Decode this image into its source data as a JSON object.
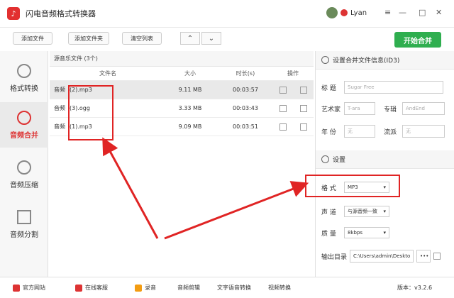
{
  "app": {
    "title": "闪电音频格式转换器",
    "username": "Lyan",
    "logo_glyph": "♪"
  },
  "window": {
    "min": "—",
    "max": "□",
    "close": "✕",
    "menu": "≡"
  },
  "toolbar": {
    "add_file": "添加文件",
    "add_folder": "添加文件夹",
    "clear_list": "清空列表",
    "up": "⌃",
    "down": "⌄",
    "start": "开始合并"
  },
  "sidebar": [
    {
      "label": "格式转换",
      "icon": "refresh-icon"
    },
    {
      "label": "音频合并",
      "icon": "merge-icon"
    },
    {
      "label": "音频压缩",
      "icon": "compress-icon"
    },
    {
      "label": "音频分割",
      "icon": "split-icon"
    }
  ],
  "filelist": {
    "title": "源音乐文件 (3个)",
    "headers": {
      "name": "文件名",
      "size": "大小",
      "duration": "时长(s)",
      "ops": "操作"
    },
    "rows": [
      {
        "prefix": "音频",
        "name": "(2).mp3",
        "size": "9.11 MB",
        "duration": "00:03:57"
      },
      {
        "prefix": "音频",
        "name": "(3).ogg",
        "size": "3.33 MB",
        "duration": "00:03:43"
      },
      {
        "prefix": "音频",
        "name": "(1).mp3",
        "size": "9.09 MB",
        "duration": "00:03:51"
      }
    ]
  },
  "id3": {
    "title": "设置合并文件信息(ID3)",
    "title_label": "标  题",
    "title_value": "Sugar Free",
    "artist_label": "艺术家",
    "artist_value": "T-ara",
    "album_label": "专辑",
    "album_value": "AndEnd",
    "year_label": "年  份",
    "year_value": "无",
    "genre_label": "流派",
    "genre_value": "无"
  },
  "settings": {
    "title": "设置",
    "format_label": "格  式",
    "format_value": "MP3",
    "channel_label": "声  道",
    "channel_value": "与源音频一致",
    "quality_label": "质  量",
    "quality_value": "8kbps",
    "output_label": "输出目录",
    "output_value": "C:\\Users\\admin\\Deskto",
    "more": "•••"
  },
  "bottom": {
    "website": "官方网站",
    "service": "在线客服",
    "record": "录音",
    "edit": "音频剪辑",
    "tts": "文字语音转换",
    "video": "视频转换",
    "version": "版本：v3.2.6"
  },
  "colors": {
    "accent": "#2fae4f",
    "highlight": "#e02424"
  }
}
